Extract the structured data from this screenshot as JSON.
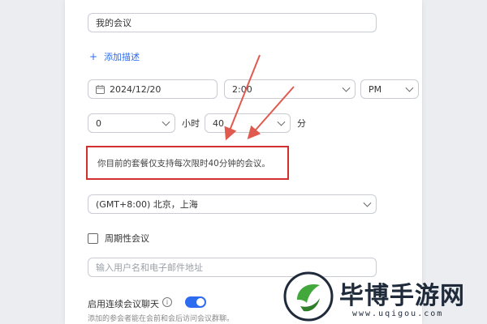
{
  "form": {
    "meeting_title_value": "我的会议",
    "add_description": "添加描述",
    "date_value": "2024/12/20",
    "time_value": "2:00",
    "ampm_value": "PM",
    "hours_value": "0",
    "hours_label": "小时",
    "minutes_value": "40",
    "minutes_label": "分",
    "limit_notice": "你目前的套餐仅支持每次限时40分钟的会议。",
    "timezone_value": "(GMT+8:00) 北京，上海",
    "recurring_label": "周期性会议",
    "invitee_placeholder": "输入用户名和电子邮件地址",
    "continuous_chat_label": "启用连续会议聊天",
    "continuous_chat_hint": "添加的参会者能在会前和会后访问会议群聊。"
  },
  "colors": {
    "accent": "#2d6cf0",
    "notice_border": "#d22f2f",
    "arrow": "#e05a4f"
  },
  "watermark": {
    "brand": "毕博手游网",
    "url": "www.uqigou.com"
  }
}
